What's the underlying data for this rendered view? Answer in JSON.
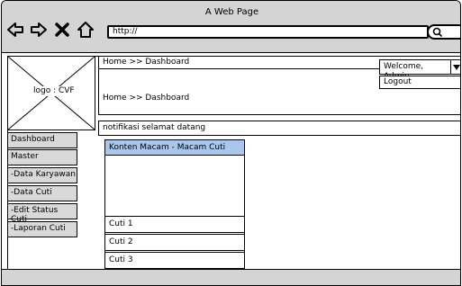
{
  "browser": {
    "title": "A Web Page",
    "url": "http://"
  },
  "logo": {
    "label": "logo : CVF"
  },
  "header": {
    "breadcrumb_top": "Home >> Dashboard",
    "breadcrumb_main": "Home >> Dashboard",
    "user_menu": {
      "label": "Welcome, Admin",
      "options": [
        "Logout"
      ]
    }
  },
  "notification": "notifikasi selamat datang",
  "sidebar": {
    "items": [
      {
        "label": "Dashboard"
      },
      {
        "label": "Master"
      },
      {
        "label": "-Data Karyawan"
      },
      {
        "label": "-Data Cuti"
      },
      {
        "label": "-Edit Status Cuti"
      },
      {
        "label": "-Laporan Cuti"
      }
    ]
  },
  "panel": {
    "header": "Konten Macam - Macam Cuti",
    "header_color": "#a9c7ec",
    "rows": [
      "Cuti 1",
      "Cuti 2",
      "Cuti 3"
    ]
  }
}
